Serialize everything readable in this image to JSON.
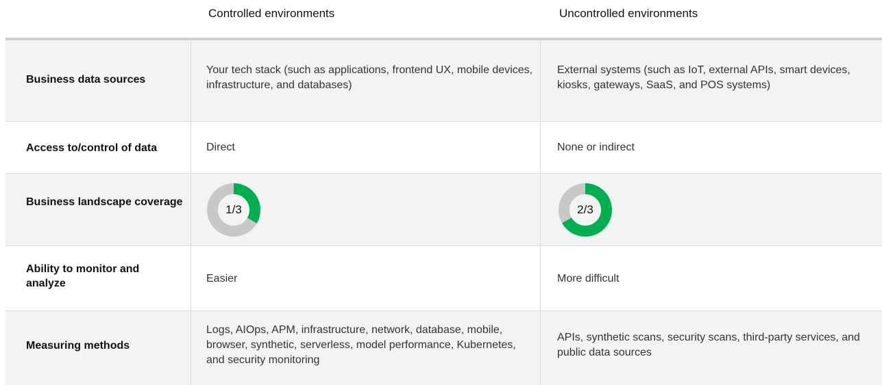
{
  "columns": {
    "controlled": "Controlled environments",
    "uncontrolled": "Uncontrolled environments"
  },
  "rows": [
    {
      "label": "Business data sources",
      "controlled": "Your tech stack (such as applications, frontend UX, mobile devices, infrastructure, and databases)",
      "uncontrolled": "External systems (such as IoT, external APIs, smart devices, kiosks, gateways, SaaS, and POS systems)"
    },
    {
      "label": "Access to/control of data",
      "controlled": "Direct",
      "uncontrolled": "None or indirect"
    },
    {
      "label": "Business landscape coverage",
      "controlled": "1/3",
      "uncontrolled": "2/3",
      "controlled_fraction": 0.3333,
      "uncontrolled_fraction": 0.6667
    },
    {
      "label": "Ability to monitor and analyze",
      "controlled": "Easier",
      "uncontrolled": "More difficult"
    },
    {
      "label": "Measuring methods",
      "controlled": "Logs, AIOps, APM, infrastructure, network, database, mobile, browser, synthetic, serverless, model performance, Kubernetes, and security monitoring",
      "uncontrolled": "APIs, synthetic scans, security scans, third-party services, and public data sources"
    }
  ],
  "colors": {
    "accent": "#00b050",
    "track": "#c8c8c8",
    "shade": "#f3f3f3"
  }
}
